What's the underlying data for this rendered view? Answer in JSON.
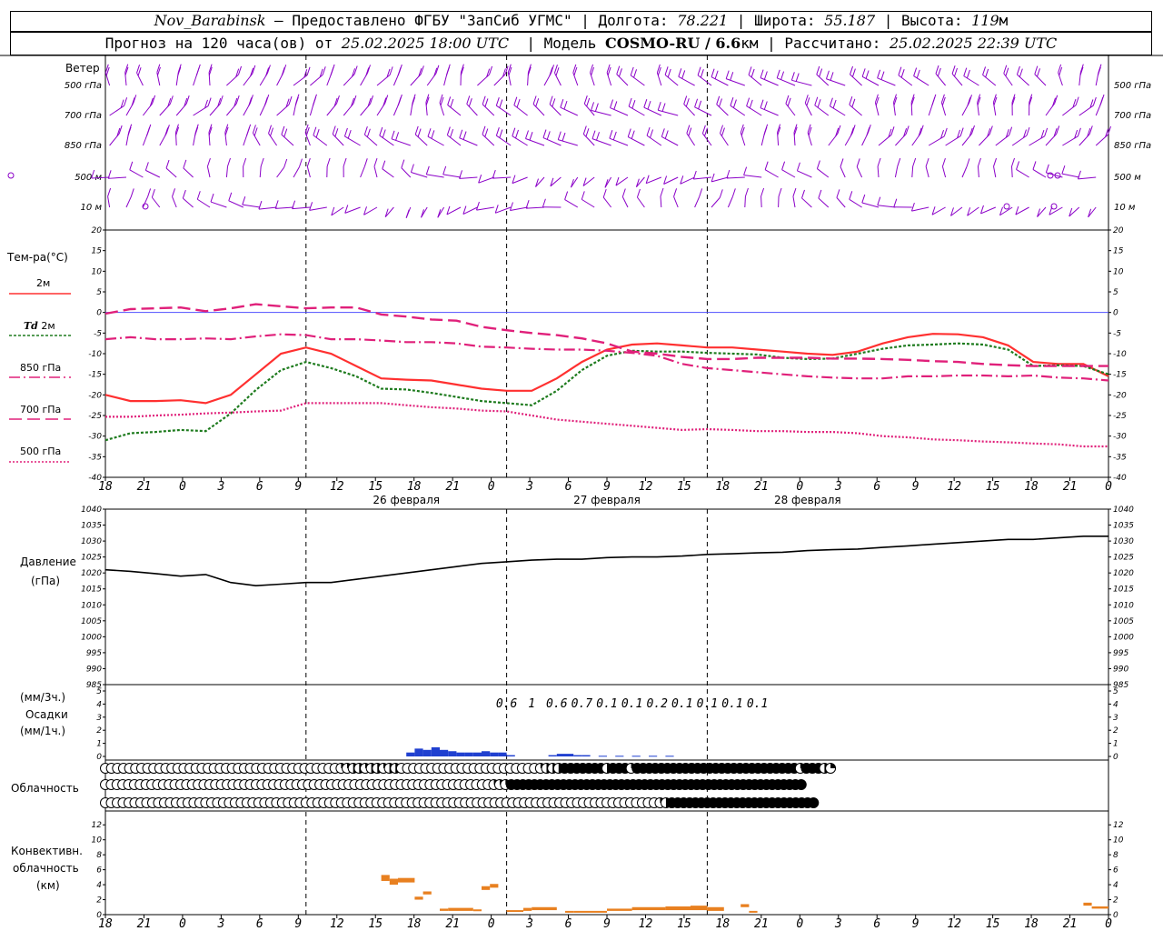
{
  "header": {
    "station": "Nov_Barabinsk",
    "dash": "–",
    "provider": "Предоставлено ФГБУ \"ЗапСиб УГМС\"",
    "lon_label": "Долгота:",
    "lon": "78.221",
    "lat_label": "Широта:",
    "lat": "55.187",
    "alt_label": "Высота:",
    "alt": "119",
    "alt_unit": "м",
    "forecast_label": "Прогноз на 120 часа(ов) от",
    "forecast_time": "25.02.2025 18:00 UTC",
    "model_label": "Модель",
    "model": "COSMO-RU / 6.6",
    "model_unit": "км",
    "calc_label": "Рассчитано:",
    "calc_time": "25.02.2025 22:39 UTC"
  },
  "colors": {
    "wind": "#8b00c8",
    "t2m": "#ff3030",
    "td2m": "#1e7b1e",
    "t850": "#e0207a",
    "t700": "#e0207a",
    "t500": "#e0207a",
    "pressure": "#000000",
    "precip": "#2040d0",
    "convective": "#e88020",
    "zero_line": "#5050ff"
  },
  "labels": {
    "wind": "Ветер",
    "wind_levels": [
      "500 гПа",
      "700 гПа",
      "850 гПа",
      "500 м",
      "10 м"
    ],
    "temp": "Тем-ра(°C)",
    "t2m": "2м",
    "td_prefix": "Td",
    "td_suffix": "2м",
    "t850": "850 гПа",
    "t700": "700 гПа",
    "t500": "500 гПа",
    "pressure": "Давление",
    "pressure_unit": "(гПа)",
    "precip_unit_top": "(мм/3ч.)",
    "precip": "Осадки",
    "precip_unit_bottom": "(мм/1ч.)",
    "cloud": "Облачность",
    "conv1": "Конвективн.",
    "conv2": "облачность",
    "conv3": "(км)"
  },
  "time_axis": {
    "hour_ticks": [
      "18",
      "21",
      "0",
      "3",
      "6",
      "9",
      "12",
      "15",
      "18",
      "21",
      "0",
      "3",
      "6",
      "9",
      "12",
      "15",
      "18",
      "21",
      "0",
      "3",
      "6",
      "9",
      "12",
      "15",
      "18",
      "21",
      "0"
    ],
    "day_labels": [
      "26 февраля",
      "27 февраля",
      "28 февраля"
    ]
  },
  "chart_data": [
    {
      "type": "line",
      "title": "Тем-ра(°C)",
      "x_unit": "hours since 25.02.2025 18:00 UTC",
      "ylim": [
        -40,
        20
      ],
      "yticks": [
        20,
        15,
        10,
        5,
        0,
        -5,
        -10,
        -15,
        -20,
        -25,
        -30,
        -35,
        -40
      ],
      "x": [
        0,
        3,
        6,
        9,
        12,
        15,
        18,
        21,
        24,
        27,
        30,
        33,
        36,
        39,
        42,
        45,
        48,
        51,
        54,
        57,
        60,
        63,
        66,
        69,
        72,
        75,
        78,
        81,
        84,
        87,
        90,
        93,
        96,
        99,
        102,
        105,
        108,
        111,
        114,
        117,
        120
      ],
      "series": [
        {
          "name": "2м",
          "values": [
            -20,
            -21.5,
            -21.5,
            -21.3,
            -22,
            -20,
            -15,
            -10,
            -8.5,
            -10,
            -13,
            -16,
            -16.3,
            -16.5,
            -17.5,
            -18.5,
            -19,
            -19,
            -16,
            -12,
            -9,
            -7.8,
            -7.5,
            -8,
            -8.5,
            -8.5,
            -9,
            -9.5,
            -10,
            -10.3,
            -9.5,
            -7.5,
            -6,
            -5.2,
            -5.3,
            -6,
            -8,
            -12,
            -12.5,
            -12.5,
            -15.5
          ]
        },
        {
          "name": "Td 2м",
          "values": [
            -31,
            -29.3,
            -29,
            -28.5,
            -28.8,
            -24.5,
            -18.8,
            -14,
            -12,
            -13.5,
            -15.5,
            -18.5,
            -18.7,
            -19.5,
            -20.5,
            -21.5,
            -22,
            -22.5,
            -19,
            -14,
            -10.5,
            -9.3,
            -9.5,
            -9.5,
            -9.8,
            -10,
            -10.2,
            -11,
            -11.3,
            -11.2,
            -10,
            -8.8,
            -8,
            -7.8,
            -7.5,
            -7.8,
            -9,
            -13,
            -12.8,
            -13,
            -15
          ]
        },
        {
          "name": "850 гПа",
          "values": [
            -6.5,
            -6,
            -6.5,
            -6.5,
            -6.3,
            -6.5,
            -5.8,
            -5.3,
            -5.5,
            -6.5,
            -6.5,
            -6.8,
            -7.2,
            -7.2,
            -7.5,
            -8.3,
            -8.5,
            -8.8,
            -9,
            -9,
            -9.3,
            -9.8,
            -10.5,
            -12.5,
            -13.5,
            -14,
            -14.5,
            -15,
            -15.5,
            -15.8,
            -16,
            -16,
            -15.5,
            -15.5,
            -15.3,
            -15.3,
            -15.5,
            -15.3,
            -15.8,
            -16,
            -16.5
          ]
        },
        {
          "name": "700 гПа",
          "values": [
            -0.3,
            0.8,
            1,
            1.2,
            0.3,
            1,
            2,
            1.5,
            1,
            1.2,
            1.2,
            -0.5,
            -1,
            -1.7,
            -2,
            -3.5,
            -4.3,
            -5,
            -5.5,
            -6.3,
            -7.5,
            -9.5,
            -10,
            -10.8,
            -11.3,
            -11.3,
            -11,
            -11,
            -11,
            -11.2,
            -11.2,
            -11.3,
            -11.5,
            -11.8,
            -12,
            -12.5,
            -12.8,
            -13,
            -13,
            -13,
            -13
          ]
        },
        {
          "name": "500 гПа",
          "values": [
            -25.3,
            -25.3,
            -25,
            -24.8,
            -24.5,
            -24.3,
            -24,
            -23.8,
            -22,
            -22,
            -22,
            -22,
            -22.5,
            -23,
            -23.3,
            -23.8,
            -24,
            -25,
            -26,
            -26.5,
            -27,
            -27.5,
            -28,
            -28.5,
            -28.3,
            -28.5,
            -28.8,
            -28.8,
            -29,
            -29,
            -29.3,
            -30,
            -30.3,
            -30.8,
            -31,
            -31.3,
            -31.5,
            -31.8,
            -32,
            -32.5,
            -32.5
          ]
        }
      ]
    },
    {
      "type": "line",
      "title": "Давление",
      "ylabel": "(гПа)",
      "ylim": [
        985,
        1040
      ],
      "yticks": [
        1040,
        1035,
        1030,
        1025,
        1020,
        1015,
        1010,
        1005,
        1000,
        995,
        990,
        985
      ],
      "x": [
        0,
        3,
        6,
        9,
        12,
        15,
        18,
        21,
        24,
        27,
        30,
        33,
        36,
        39,
        42,
        45,
        48,
        51,
        54,
        57,
        60,
        63,
        66,
        69,
        72,
        75,
        78,
        81,
        84,
        87,
        90,
        93,
        96,
        99,
        102,
        105,
        108,
        111,
        114,
        117,
        120
      ],
      "series": [
        {
          "name": "Давление",
          "values": [
            1021,
            1020.5,
            1019.8,
            1019,
            1019.5,
            1017,
            1016,
            1016.5,
            1017,
            1017,
            1018,
            1019,
            1020,
            1021,
            1022,
            1023,
            1023.5,
            1024,
            1024.3,
            1024.3,
            1024.8,
            1025,
            1025,
            1025.3,
            1025.8,
            1026,
            1026.3,
            1026.5,
            1027,
            1027.3,
            1027.5,
            1028,
            1028.5,
            1029,
            1029.5,
            1030,
            1030.5,
            1030.5,
            1031,
            1031.5,
            1031.5
          ]
        }
      ]
    },
    {
      "type": "bar",
      "title": "Осадки",
      "ylim": [
        0,
        5
      ],
      "yticks": [
        5,
        4,
        3,
        2,
        1,
        0
      ],
      "precip_3h_labels": [
        {
          "x": 48,
          "text": "0.6"
        },
        {
          "x": 51,
          "text": "1"
        },
        {
          "x": 54,
          "text": "0.6"
        },
        {
          "x": 57,
          "text": "0.7"
        },
        {
          "x": 60,
          "text": "0.1"
        },
        {
          "x": 63,
          "text": "0.1"
        },
        {
          "x": 66,
          "text": "0.2"
        },
        {
          "x": 69,
          "text": "0.1"
        },
        {
          "x": 72,
          "text": "0.1"
        },
        {
          "x": 75,
          "text": "0.1"
        },
        {
          "x": 78,
          "text": "0.1"
        }
      ],
      "precip_1h": [
        {
          "x": 37,
          "value": 0.3
        },
        {
          "x": 38,
          "value": 0.6
        },
        {
          "x": 39,
          "value": 0.5
        },
        {
          "x": 40,
          "value": 0.7
        },
        {
          "x": 41,
          "value": 0.5
        },
        {
          "x": 42,
          "value": 0.4
        },
        {
          "x": 43,
          "value": 0.3
        },
        {
          "x": 44,
          "value": 0.3
        },
        {
          "x": 45,
          "value": 0.3
        },
        {
          "x": 46,
          "value": 0.4
        },
        {
          "x": 47,
          "value": 0.3
        },
        {
          "x": 48,
          "value": 0.3
        },
        {
          "x": 49,
          "value": 0.1
        },
        {
          "x": 54,
          "value": 0.1
        },
        {
          "x": 55,
          "value": 0.2
        },
        {
          "x": 56,
          "value": 0.2
        },
        {
          "x": 57,
          "value": 0.1
        },
        {
          "x": 58,
          "value": 0.1
        },
        {
          "x": 60,
          "value": 0.05
        },
        {
          "x": 62,
          "value": 0.05
        },
        {
          "x": 64,
          "value": 0.05
        },
        {
          "x": 66,
          "value": 0.05
        },
        {
          "x": 68,
          "value": 0.05
        }
      ]
    },
    {
      "type": "bar",
      "title": "Конвективн. облачность (км)",
      "ylim": [
        0,
        13
      ],
      "yticks": [
        12,
        10,
        8,
        6,
        4,
        2,
        0
      ],
      "conv_bars": [
        {
          "x0": 33,
          "x1": 34,
          "base": 4.5,
          "top": 5.3
        },
        {
          "x0": 34,
          "x1": 35,
          "base": 4.0,
          "top": 4.8
        },
        {
          "x0": 35,
          "x1": 37,
          "base": 4.3,
          "top": 4.9
        },
        {
          "x0": 37,
          "x1": 38,
          "base": 2.0,
          "top": 2.4
        },
        {
          "x0": 38,
          "x1": 39,
          "base": 2.7,
          "top": 3.1
        },
        {
          "x0": 40,
          "x1": 41,
          "base": 0.5,
          "top": 0.8
        },
        {
          "x0": 41,
          "x1": 44,
          "base": 0.5,
          "top": 0.9
        },
        {
          "x0": 44,
          "x1": 45,
          "base": 0.5,
          "top": 0.7
        },
        {
          "x0": 45,
          "x1": 46,
          "base": 3.3,
          "top": 3.8
        },
        {
          "x0": 46,
          "x1": 47,
          "base": 3.6,
          "top": 4.1
        },
        {
          "x0": 48,
          "x1": 50,
          "base": 0.4,
          "top": 0.6
        },
        {
          "x0": 50,
          "x1": 51,
          "base": 0.5,
          "top": 0.9
        },
        {
          "x0": 51,
          "x1": 54,
          "base": 0.6,
          "top": 1.0
        },
        {
          "x0": 55,
          "x1": 56,
          "base": 0.3,
          "top": 0.5
        },
        {
          "x0": 56,
          "x1": 60,
          "base": 0.3,
          "top": 0.5
        },
        {
          "x0": 60,
          "x1": 63,
          "base": 0.5,
          "top": 0.8
        },
        {
          "x0": 63,
          "x1": 67,
          "base": 0.6,
          "top": 1.0
        },
        {
          "x0": 67,
          "x1": 70,
          "base": 0.6,
          "top": 1.1
        },
        {
          "x0": 70,
          "x1": 72,
          "base": 0.6,
          "top": 1.2
        },
        {
          "x0": 72,
          "x1": 74,
          "base": 0.5,
          "top": 1.0
        },
        {
          "x0": 76,
          "x1": 77,
          "base": 1.0,
          "top": 1.4
        },
        {
          "x0": 77,
          "x1": 78,
          "base": 0.3,
          "top": 0.5
        },
        {
          "x0": 117,
          "x1": 118,
          "base": 1.2,
          "top": 1.6
        },
        {
          "x0": 118,
          "x1": 120,
          "base": 0.8,
          "top": 1.1
        }
      ]
    }
  ],
  "cloud_rows": {
    "upper": "oooooooooooooooooooooooooooooooooooooooqqhhqhhqhhoooooooooooooooooooooooqhhhfffffffhfffqfffffffffffffffffffffffffffqfffhqfqhhhhhhqhhhhhhfqqoqqqqqqqqqqqqqqqqqqqqqqhhqqq",
    "middle": "oooooooooooooooooooooooooooooooooooooooooooooooooooooooooooooooooooqqqffffffffffffffffffffffffffffffffffffffffffffffffffffffffffffffffffffffffffffffffffffffffffhhhfffffffffff",
    "lower": "ooooooooooooooooooooooooooooooooooooooooooooooooooooooooooooooooooooooooooooooooooooooooooooooqhfffffffffffffffffffffffffffqqqqhfffffffffffffffffffffffffffffffffffqhfqqfhf"
  }
}
